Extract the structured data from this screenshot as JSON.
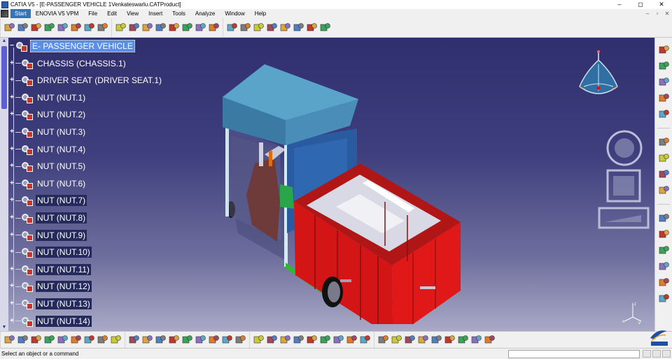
{
  "window": {
    "title": "CATIA V5 - [E-PASSENGER VEHICLE 1Venkateswarlu.CATProduct]",
    "controls": [
      "–",
      "◻",
      "✕"
    ]
  },
  "menubar": {
    "items": [
      "Start",
      "ENOVIA V5 VPM",
      "File",
      "Edit",
      "View",
      "Insert",
      "Tools",
      "Analyze",
      "Window",
      "Help"
    ],
    "active": "Start",
    "doc_controls": [
      "–",
      "▫",
      "✕"
    ]
  },
  "tree": {
    "root": "E- PASSENGER VEHICLE",
    "nodes": [
      "CHASSIS (CHASSIS.1)",
      "DRIVER SEAT (DRIVER SEAT.1)",
      "NUT (NUT.1)",
      "NUT (NUT.2)",
      "NUT (NUT.3)",
      "NUT (NUT.4)",
      "NUT (NUT.5)",
      "NUT (NUT.6)",
      "NUT (NUT.7)",
      "NUT (NUT.8)",
      "NUT (NUT.9)",
      "NUT (NUT.10)",
      "NUT (NUT.11)",
      "NUT (NUT.12)",
      "NUT (NUT.13)",
      "NUT (NUT.14)"
    ]
  },
  "icons": {
    "top_toolbar": [
      "assembly-icon",
      "constraint-icon",
      "component-icon",
      "replace-icon",
      "reorder-icon",
      "multi-instantiate-icon",
      "snap-icon",
      "explode-icon",
      "stop-manipulate-icon",
      "clash-icon",
      "section-icon",
      "distance-icon",
      "fix-icon",
      "coincidence-icon",
      "contact-icon",
      "offset-icon",
      "angle-icon",
      "fix-together-icon",
      "quick-constraint-icon",
      "flexible-icon",
      "update-icon",
      "catalog-icon",
      "scenes-icon",
      "annotations-icon"
    ],
    "bottom_toolbar": [
      "new-icon",
      "open-icon",
      "save-icon",
      "print-icon",
      "cut-icon",
      "copy-icon",
      "paste-icon",
      "undo-icon",
      "redo-icon",
      "whats-this-icon",
      "fly-mode-icon",
      "fit-all-icon",
      "pan-icon",
      "rotate-icon",
      "zoom-in-icon",
      "zoom-out-icon",
      "normal-view-icon",
      "multi-view-icon",
      "iso-view-icon",
      "render-style-icon",
      "hide-show-icon",
      "swap-space-icon",
      "formula-icon",
      "knowledge-icon",
      "table-icon",
      "grid-icon",
      "catalog-browser-icon",
      "publication-icon",
      "measure-between-icon",
      "measure-item-icon",
      "measure-inertia-icon",
      "capture-icon",
      "sketch-analysis-icon",
      "apply-material-icon",
      "photo-studio-icon",
      "refresh-icon"
    ],
    "right_toolbar": [
      "product-icon",
      "new-component-icon",
      "new-product-icon",
      "new-part-icon",
      "existing-component-icon",
      "select-icon",
      "manipulation-icon",
      "symbol-icon",
      "frame-icon",
      "spec-tree-icon",
      "publish-icon",
      "material-icon",
      "analysis-icon",
      "hierarchy-icon",
      "bom-icon"
    ]
  },
  "statusbar": {
    "message": "Select an object or a command",
    "command_value": ""
  },
  "brand": {
    "logo": "CATIA"
  },
  "colors": {
    "viewport_top": "#302f6e",
    "viewport_bottom": "#a9a9c6",
    "selection": "#5b8ee6",
    "cargo_box": "#d41515",
    "cabin_roof": "#4a90b8"
  }
}
